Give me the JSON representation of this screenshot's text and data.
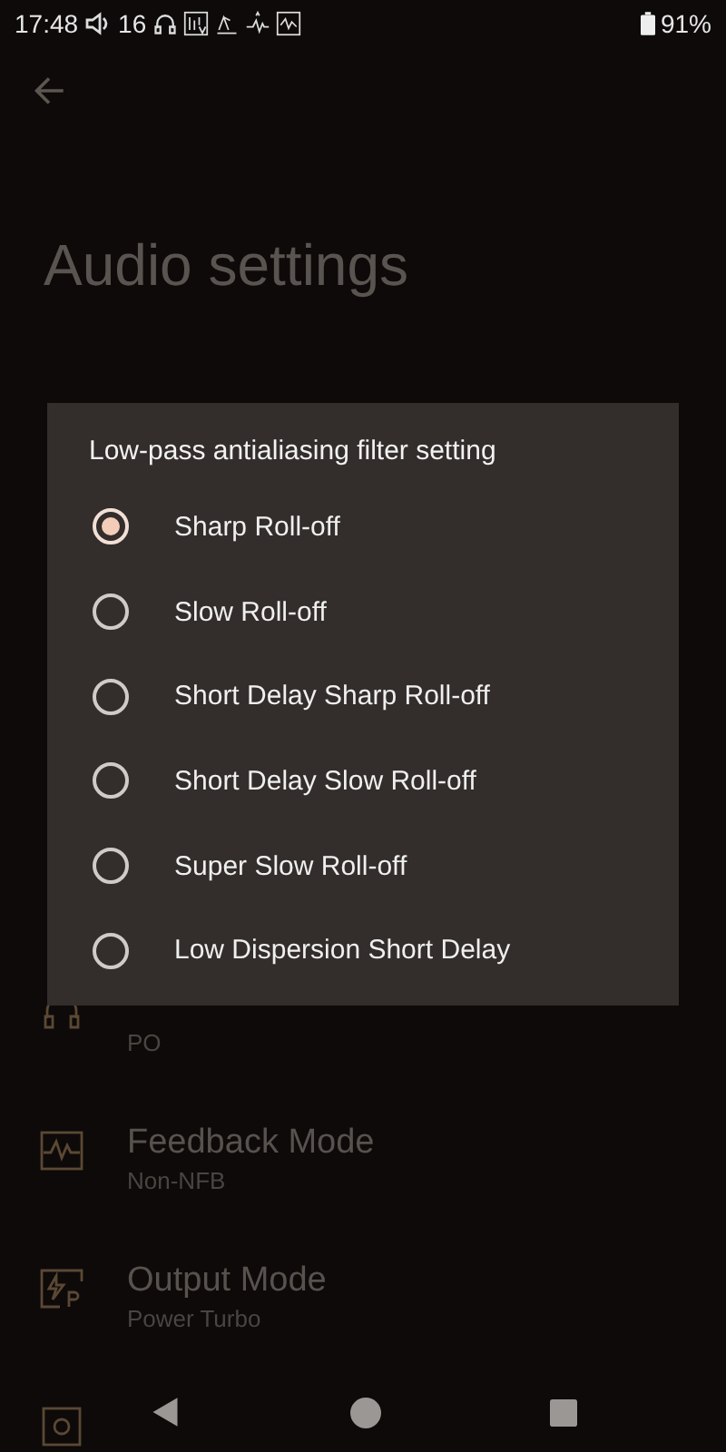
{
  "status_bar": {
    "time": "17:48",
    "volume": "16",
    "battery": "91%"
  },
  "page": {
    "title": "Audio settings"
  },
  "settings": [
    {
      "kind": "headphones",
      "value": "PO"
    },
    {
      "kind": "wave",
      "title": "Feedback Mode",
      "value": "Non-NFB"
    },
    {
      "kind": "power",
      "title": "Output Mode",
      "value": "Power Turbo"
    },
    {
      "kind": "circuit"
    }
  ],
  "dialog": {
    "title": "Low-pass antialiasing filter setting",
    "options": [
      {
        "label": "Sharp Roll-off",
        "selected": true
      },
      {
        "label": "Slow Roll-off",
        "selected": false
      },
      {
        "label": "Short Delay Sharp Roll-off",
        "selected": false
      },
      {
        "label": "Short Delay Slow Roll-off",
        "selected": false
      },
      {
        "label": "Super Slow Roll-off",
        "selected": false
      },
      {
        "label": "Low Dispersion Short Delay",
        "selected": false
      }
    ]
  }
}
